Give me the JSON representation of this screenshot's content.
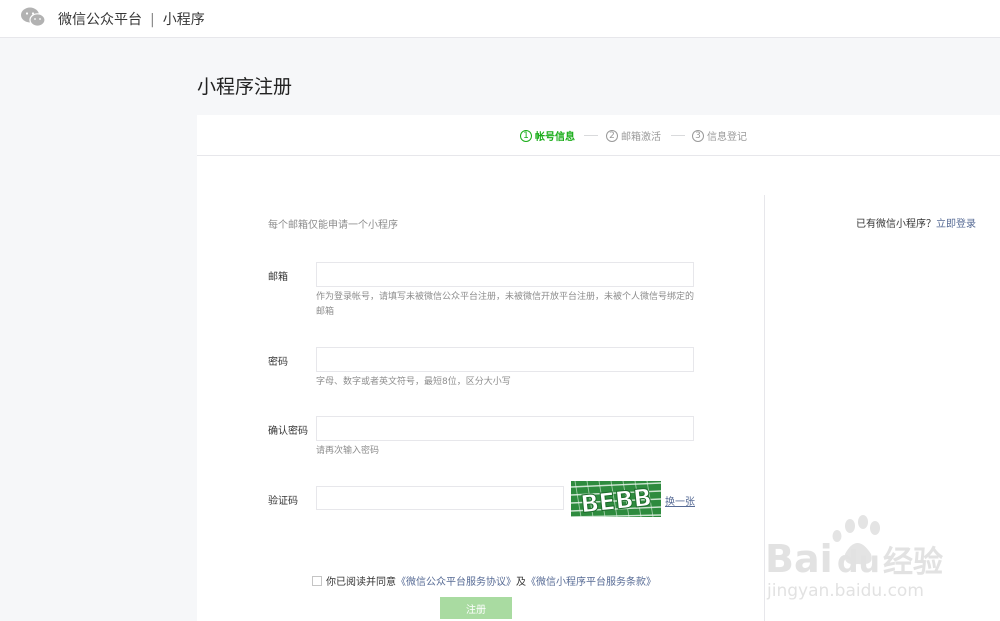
{
  "header": {
    "platform_name": "微信公众平台",
    "separator": "|",
    "product_name": "小程序"
  },
  "page_title": "小程序注册",
  "steps": [
    {
      "num": "1",
      "label": "帐号信息",
      "active": true
    },
    {
      "num": "2",
      "label": "邮箱激活",
      "active": false
    },
    {
      "num": "3",
      "label": "信息登记",
      "active": false
    }
  ],
  "right_note": {
    "text": "已有微信小程序？",
    "link": "立即登录"
  },
  "form": {
    "hint": "每个邮箱仅能申请一个小程序",
    "email": {
      "label": "邮箱",
      "value": "",
      "tip": "作为登录帐号，请填写未被微信公众平台注册，未被微信开放平台注册，未被个人微信号绑定的邮箱"
    },
    "password": {
      "label": "密码",
      "value": "",
      "tip": "字母、数字或者英文符号，最短8位，区分大小写"
    },
    "confirm": {
      "label": "确认密码",
      "value": "",
      "tip": "请再次输入密码"
    },
    "captcha": {
      "label": "验证码",
      "value": "",
      "image_text": "BEBB",
      "refresh": "换一张"
    },
    "agreement": {
      "prefix": "你已阅读并同意",
      "link1": "《微信公众平台服务协议》",
      "middle": "及",
      "link2": "《微信小程序平台服务条款》",
      "checked": false
    },
    "submit": "注册"
  },
  "watermark": {
    "brand_latin": "Bai",
    "brand_mid": "du",
    "brand_cn": "经验",
    "url": "jingyan.baidu.com"
  },
  "colors": {
    "accent": "#1aad19",
    "link": "#576b95",
    "submit_disabled": "#a9dba1"
  }
}
